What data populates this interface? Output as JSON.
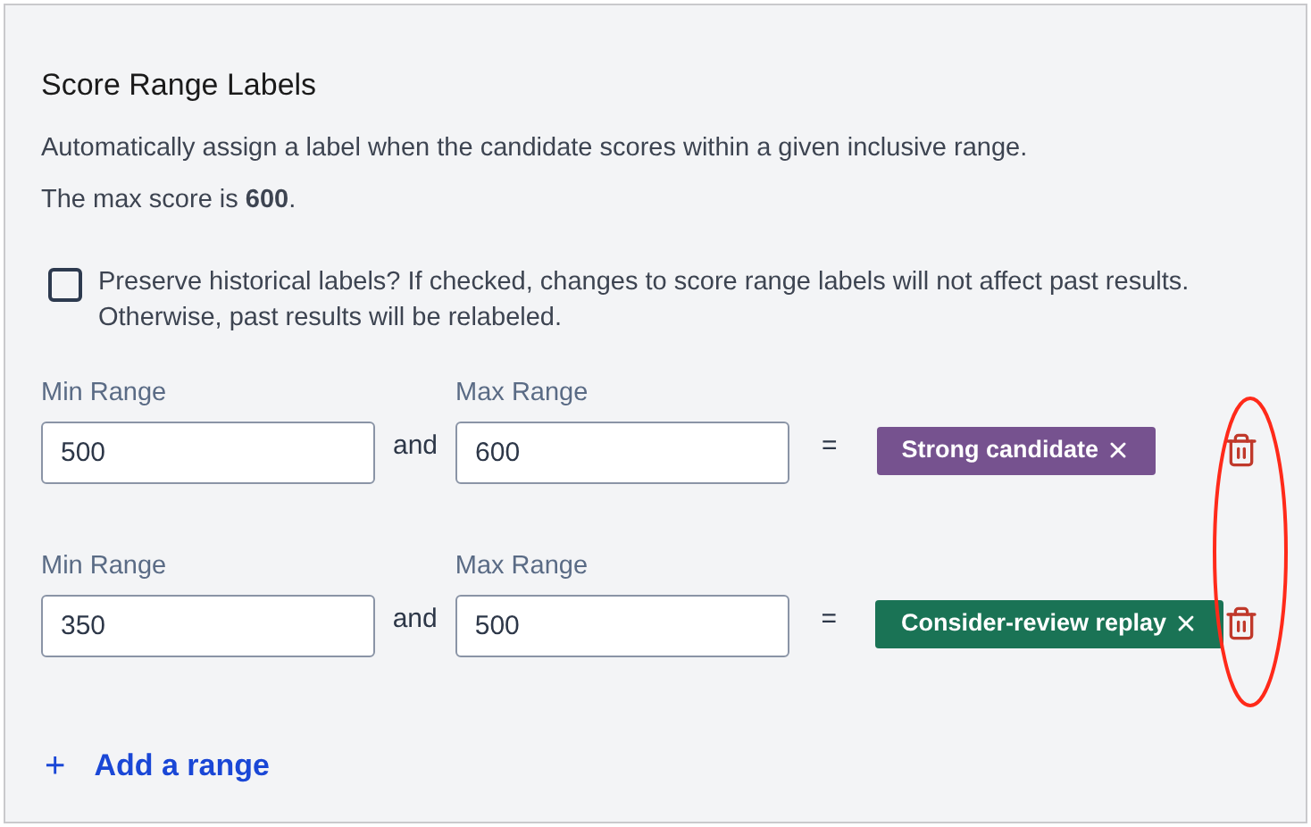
{
  "section": {
    "title": "Score Range Labels",
    "description": "Automatically assign a label when the candidate scores within a given inclusive range.",
    "max_note": "The max score is **600**."
  },
  "preserve_option": {
    "label": "Preserve historical labels? If checked, changes to score range labels will not affect past results. Otherwise, past results will be relabeled.",
    "checked": false
  },
  "ranges": [
    {
      "min_label": "Min Range",
      "min_value": "500",
      "joiner": "and",
      "max_label": "Max Range",
      "max_value": "600",
      "equals": "=",
      "tag": "Strong candidate",
      "color": "#76528f"
    },
    {
      "min_label": "Min Range",
      "min_value": "350",
      "joiner": "and",
      "max_label": "Max Range",
      "max_value": "500",
      "equals": "=",
      "tag": "Consider-review replay",
      "color": "#1a7355"
    }
  ],
  "add_link": {
    "icon": "+",
    "label": "Add a range"
  },
  "annotation": {
    "kind": "ellipse"
  }
}
